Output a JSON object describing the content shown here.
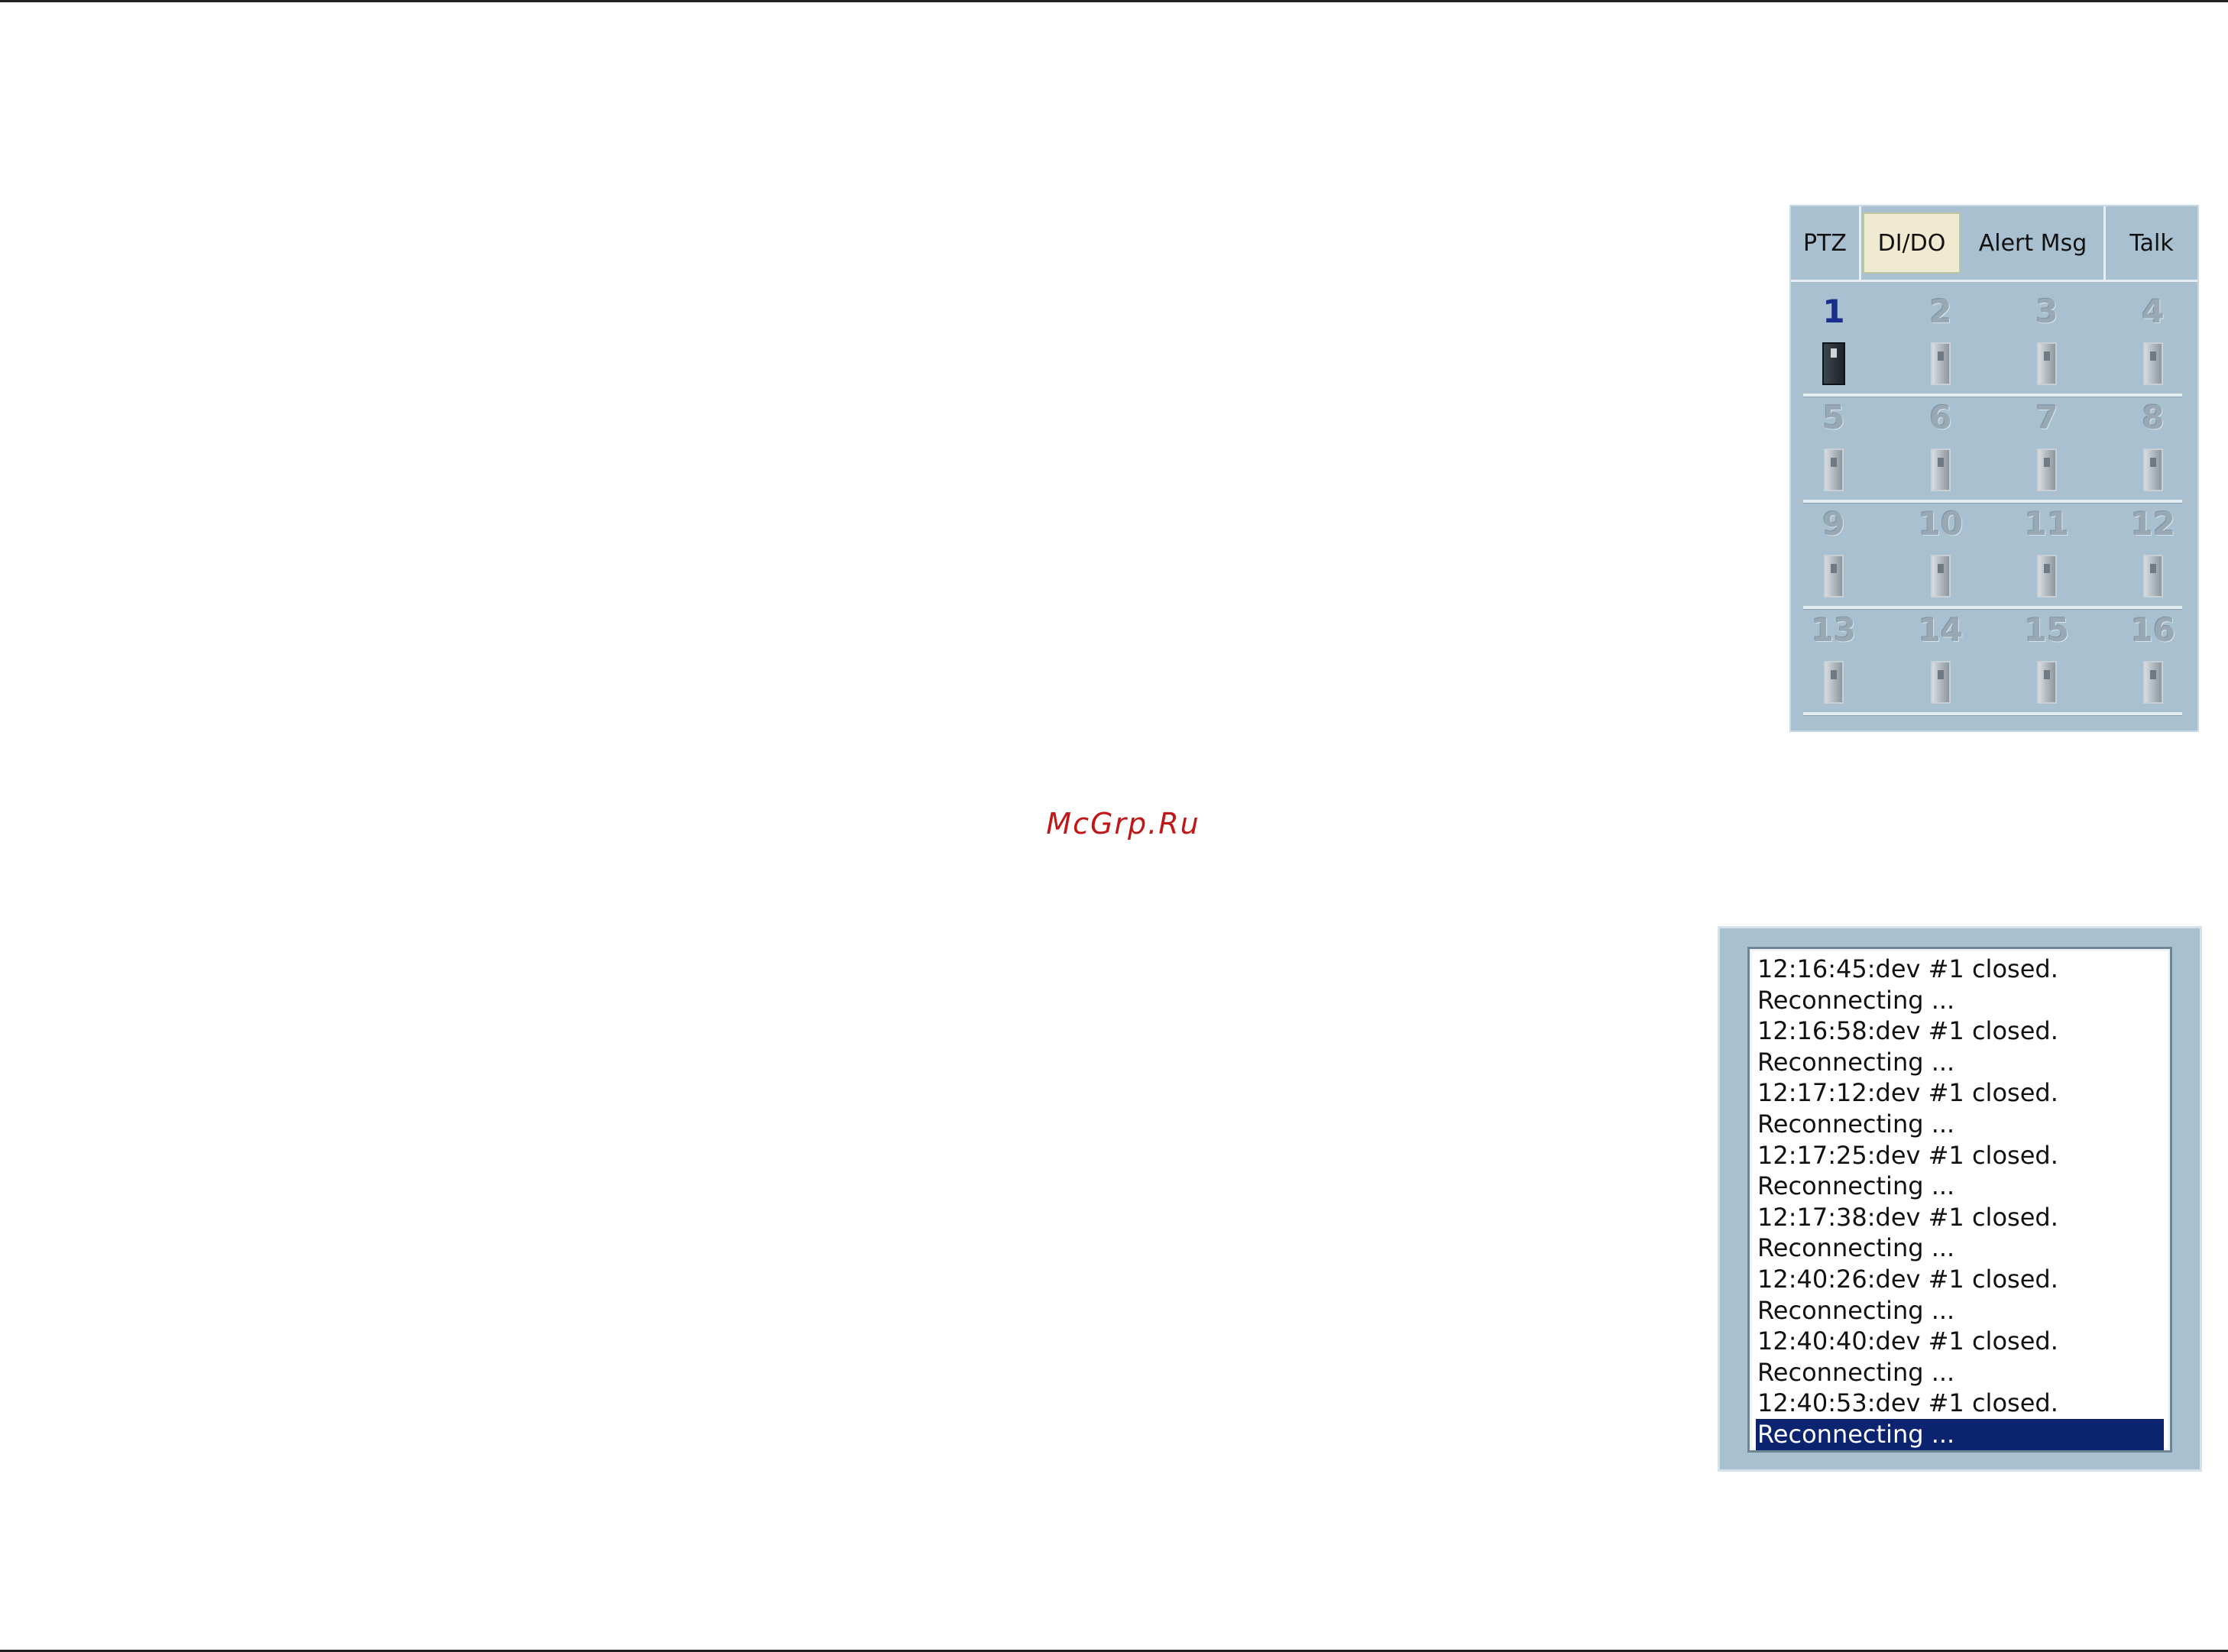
{
  "watermark": "McGrp.Ru",
  "dido_panel": {
    "tabs": [
      {
        "label": "PTZ",
        "selected": false
      },
      {
        "label": "DI/DO",
        "selected": true
      },
      {
        "label": "Alert Msg",
        "selected": false
      },
      {
        "label": "Talk",
        "selected": false
      }
    ],
    "channels": [
      {
        "number": "1",
        "state": "on"
      },
      {
        "number": "2",
        "state": "off"
      },
      {
        "number": "3",
        "state": "off"
      },
      {
        "number": "4",
        "state": "off"
      },
      {
        "number": "5",
        "state": "off"
      },
      {
        "number": "6",
        "state": "off"
      },
      {
        "number": "7",
        "state": "off"
      },
      {
        "number": "8",
        "state": "off"
      },
      {
        "number": "9",
        "state": "off"
      },
      {
        "number": "10",
        "state": "off"
      },
      {
        "number": "11",
        "state": "off"
      },
      {
        "number": "12",
        "state": "off"
      },
      {
        "number": "13",
        "state": "off"
      },
      {
        "number": "14",
        "state": "off"
      },
      {
        "number": "15",
        "state": "off"
      },
      {
        "number": "16",
        "state": "off"
      }
    ],
    "active_color": "#1a2e8c",
    "panel_color": "#a9c0d0"
  },
  "log_panel": {
    "lines": [
      "12:16:45:dev #1 closed.",
      "Reconnecting ...",
      "12:16:58:dev #1 closed.",
      "Reconnecting ...",
      "12:17:12:dev #1 closed.",
      "Reconnecting ...",
      "12:17:25:dev #1 closed.",
      "Reconnecting ...",
      "12:17:38:dev #1 closed.",
      "Reconnecting ...",
      "12:40:26:dev #1 closed.",
      "Reconnecting ...",
      "12:40:40:dev #1 closed.",
      "Reconnecting ...",
      "12:40:53:dev #1 closed.",
      "Reconnecting ..."
    ],
    "selected_index": 15,
    "selection_color": "#0c2470"
  }
}
